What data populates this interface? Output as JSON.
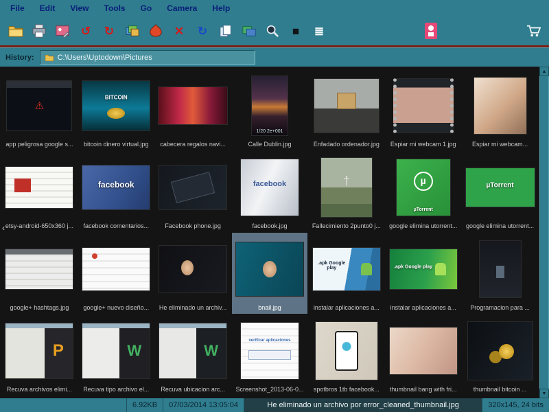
{
  "menu": {
    "items": [
      "File",
      "Edit",
      "View",
      "Tools",
      "Go",
      "Camera",
      "Help"
    ]
  },
  "toolbar": {
    "glyphs": {
      "rotate_left": "↺",
      "rotate_right": "↻",
      "delete": "✕",
      "refresh": "↻",
      "fullscreen": "■",
      "checklist": "≣"
    }
  },
  "icons": {
    "collapse_left": "‹",
    "scroll_up": "▲",
    "scroll_down": "▼"
  },
  "history": {
    "label": "History:",
    "path": "C:\\Users\\Uptodown\\Pictures"
  },
  "grid": {
    "items": [
      {
        "caption": "app peligrosa google s..."
      },
      {
        "caption": "bitcoin dinero virtual.jpg",
        "label": "BITCOIN"
      },
      {
        "caption": "cabecera regalos navi..."
      },
      {
        "caption": "Calle Dublin.jpg",
        "label": "1/20  2e+001"
      },
      {
        "caption": "Enfadado ordenador.jpg"
      },
      {
        "caption": "Espiar mi webcam 1.jpg"
      },
      {
        "caption": "Espiar mi webcam..."
      },
      {
        "caption": "etsy-android-650x360 j..."
      },
      {
        "caption": "facebook comentarios...",
        "label": "facebook"
      },
      {
        "caption": "Facebook phone.jpg"
      },
      {
        "caption": "facebook.jpg",
        "label": "facebook"
      },
      {
        "caption": "Fallecimiento 2punto0 j..."
      },
      {
        "caption": "google elimina utorrent...",
        "label": "µTorrent"
      },
      {
        "caption": "google elimina utorrent...",
        "label": "µTorrent"
      },
      {
        "caption": "google+ hashtags.jpg"
      },
      {
        "caption": "google+ nuevo diseño..."
      },
      {
        "caption": "He eliminado un archiv..."
      },
      {
        "caption": "bnail.jpg",
        "selected": true
      },
      {
        "caption": "instalar aplicaciones a...",
        "label": ".apk Google play"
      },
      {
        "caption": "instalar aplicaciones a...",
        "label": ".apk Google play"
      },
      {
        "caption": "Programacion para ..."
      },
      {
        "caption": "Recuva archivos elimi..."
      },
      {
        "caption": "Recuva tipo archivo el..."
      },
      {
        "caption": "Recuva ubicacion arc..."
      },
      {
        "caption": "Screenshot_2013-06-0...",
        "label": "verificar aplicaciones"
      },
      {
        "caption": "spotbros 1tb facebook..."
      },
      {
        "caption": "thumbnail bang with fri..."
      },
      {
        "caption": "thumbnail bitcoin ..."
      }
    ]
  },
  "status": {
    "size": "6.92KB",
    "datetime": "07/03/2014 13:05:04",
    "filename": "He eliminado un archivo por error_cleaned_thumbnail.jpg",
    "dimensions": "320x145, 24 bits"
  },
  "colors": {
    "chrome_teal": "#2f7d8e",
    "separator_red": "#7d1d12",
    "content_bg": "#141414",
    "selection": "#5e7385",
    "menu_text": "#0a1f7a"
  }
}
